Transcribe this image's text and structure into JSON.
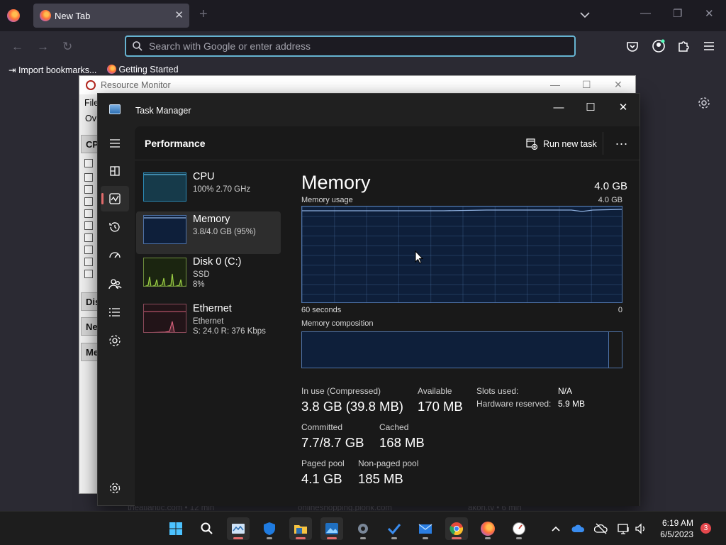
{
  "firefox": {
    "tab_title": "New Tab",
    "url_placeholder": "Search with Google or enter address",
    "bookmarks": [
      "Import bookmarks...",
      "Getting Started"
    ],
    "faded_tiles": [
      "theatlantic.com • 12 min",
      "onlineshopping.plonk.com",
      "akon.tv • 6 min"
    ]
  },
  "resource_monitor": {
    "title": "Resource Monitor",
    "menu_file": "File",
    "tab_overview": "Ov",
    "sections": [
      "CP",
      "Dis",
      "Ne",
      "Me"
    ]
  },
  "task_manager": {
    "title": "Task Manager",
    "page_title": "Performance",
    "run_new_task": "Run new task",
    "more": "...",
    "devices": [
      {
        "name": "CPU",
        "sub1": "100%  2.70 GHz",
        "sub2": "",
        "sub3": ""
      },
      {
        "name": "Memory",
        "sub1": "3.8/4.0 GB (95%)",
        "sub2": "",
        "sub3": ""
      },
      {
        "name": "Disk 0 (C:)",
        "sub1": "SSD",
        "sub2": "8%",
        "sub3": ""
      },
      {
        "name": "Ethernet",
        "sub1": "Ethernet",
        "sub2": "S: 24.0  R: 376 Kbps",
        "sub3": ""
      }
    ],
    "memory": {
      "title": "Memory",
      "total": "4.0 GB",
      "usage_label": "Memory usage",
      "usage_max": "4.0 GB",
      "time_left": "60 seconds",
      "time_right": "0",
      "composition_label": "Memory composition",
      "composition_used_fraction": 0.96,
      "in_use_label": "In use (Compressed)",
      "in_use_value": "3.8 GB (39.8 MB)",
      "available_label": "Available",
      "available_value": "170 MB",
      "committed_label": "Committed",
      "committed_value": "7.7/8.7 GB",
      "cached_label": "Cached",
      "cached_value": "168 MB",
      "paged_label": "Paged pool",
      "paged_value": "4.1 GB",
      "nonpaged_label": "Non-paged pool",
      "nonpaged_value": "185 MB",
      "slots_label": "Slots used:",
      "slots_value": "N/A",
      "hw_reserved_label": "Hardware reserved:",
      "hw_reserved_value": "5.9 MB"
    }
  },
  "taskbar": {
    "time": "6:19 AM",
    "date": "6/5/2023",
    "notifications": "3"
  },
  "colors": {
    "graph_fill": "#0e1f3a",
    "graph_border": "#4f73a8",
    "accent_red": "#e06a6a"
  }
}
